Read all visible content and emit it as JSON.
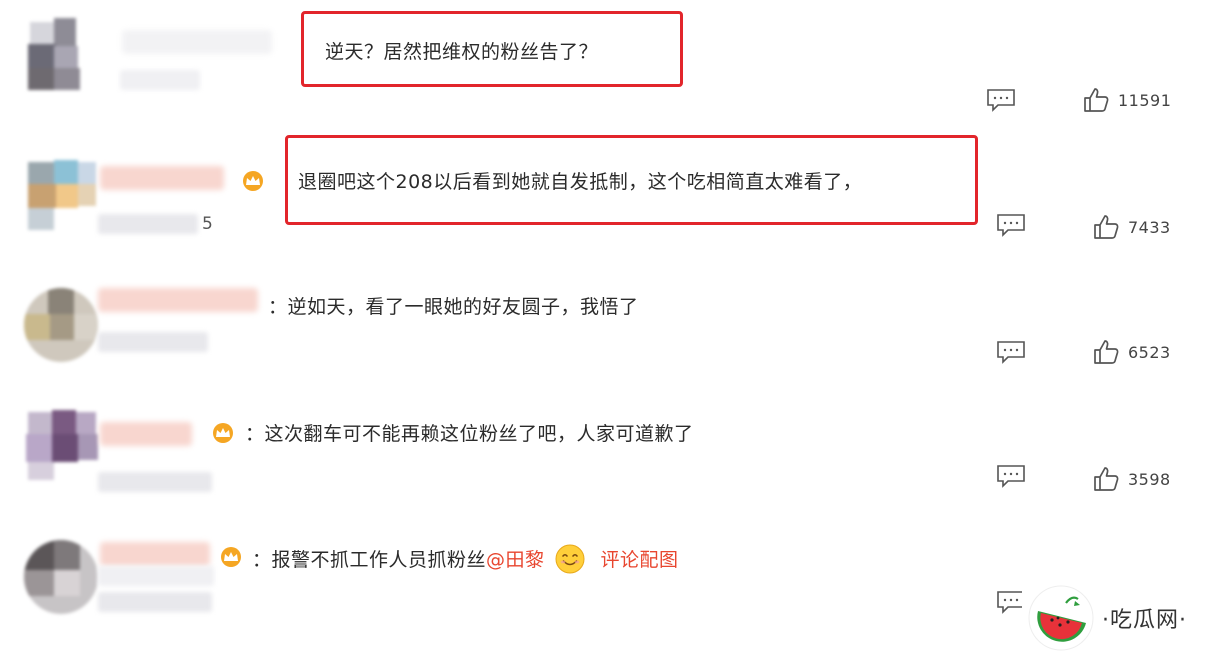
{
  "comments": [
    {
      "text": "逆天？居然把维权的粉丝告了？",
      "likes": "11591"
    },
    {
      "text": "退圈吧这个208以后看到她就自发抵制，这个吃相简直太难看了，",
      "meta_suffix": "5",
      "likes": "7433"
    },
    {
      "text": "逆如天，看了一眼她的好友圆子，我悟了",
      "likes": "6523"
    },
    {
      "text": "这次翻车可不能再赖这位粉丝了吧，人家可道歉了",
      "likes": "3598"
    },
    {
      "text": "报警不抓工作人员抓粉丝",
      "mention": "@田黎",
      "pic_link": "评论配图"
    }
  ],
  "separator": "：",
  "icons": {
    "reply": "comment-reply-icon",
    "like": "thumbs-up-icon",
    "badge": "vip-crown-icon",
    "emoji": "smile-emoji-icon",
    "logo": "watermelon-logo-icon"
  },
  "colors": {
    "highlight": "#e2252b",
    "mention": "#e8462f",
    "badge": "#f5a623"
  },
  "watermark": {
    "text": "·吃瓜网·"
  }
}
